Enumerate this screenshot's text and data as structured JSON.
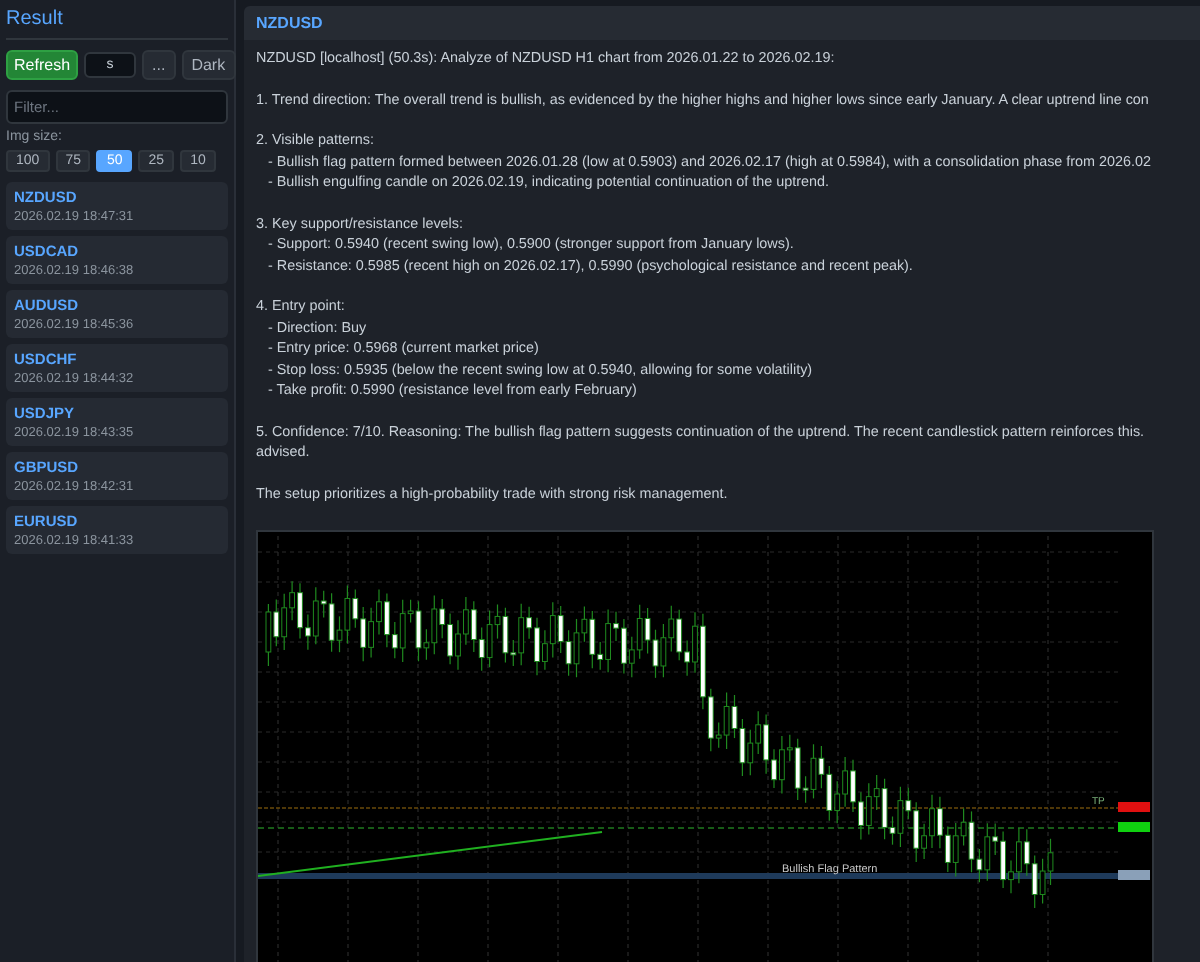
{
  "sidebar": {
    "title": "Result",
    "refresh_button": "Refresh",
    "interval_field": {
      "value": "s"
    },
    "more_button": "...",
    "theme_button": "Dark",
    "filter_field": {
      "placeholder": "Filter..."
    },
    "img_size_label": "Img size:",
    "img_sizes": [
      {
        "label": "100",
        "selected": false
      },
      {
        "label": "75",
        "selected": false
      },
      {
        "label": "50",
        "selected": true
      },
      {
        "label": "25",
        "selected": false
      },
      {
        "label": "10",
        "selected": false
      }
    ],
    "items": [
      {
        "symbol": "NZDUSD",
        "time": "2026.02.19 18:47:31"
      },
      {
        "symbol": "USDCAD",
        "time": "2026.02.19 18:46:38"
      },
      {
        "symbol": "AUDUSD",
        "time": "2026.02.19 18:45:36"
      },
      {
        "symbol": "USDCHF",
        "time": "2026.02.19 18:44:32"
      },
      {
        "symbol": "USDJPY",
        "time": "2026.02.19 18:43:35"
      },
      {
        "symbol": "GBPUSD",
        "time": "2026.02.19 18:42:31"
      },
      {
        "symbol": "EURUSD",
        "time": "2026.02.19 18:41:33"
      }
    ]
  },
  "main": {
    "title": "NZDUSD",
    "paragraphs": [
      [
        "NZDUSD [localhost] (50.3s): Analyze of NZDUSD H1 chart from 2026.01.22 to 2026.02.19:"
      ],
      [
        "1. Trend direction: The overall trend is bullish, as evidenced by the higher highs and higher lows since early January. A clear uptrend line con"
      ],
      [
        "2. Visible patterns:",
        "   - Bullish flag pattern formed between 2026.01.28 (low at 0.5903) and 2026.02.17 (high at 0.5984), with a consolidation phase from 2026.02",
        "   - Bullish engulfing candle on 2026.02.19, indicating potential continuation of the uptrend."
      ],
      [
        "3. Key support/resistance levels:",
        "   - Support: 0.5940 (recent swing low), 0.5900 (stronger support from January lows).",
        "   - Resistance: 0.5985 (recent high on 2026.02.17), 0.5990 (psychological resistance and recent peak)."
      ],
      [
        "4. Entry point:",
        "   - Direction: Buy",
        "   - Entry price: 0.5968 (current market price)",
        "   - Stop loss: 0.5935 (below the recent swing low at 0.5940, allowing for some volatility)",
        "   - Take profit: 0.5990 (resistance level from early February)"
      ],
      [
        "5. Confidence: 7/10. Reasoning: The bullish flag pattern suggests continuation of the uptrend. The recent candlestick pattern reinforces this.",
        "advised."
      ],
      [
        "The setup prioritizes a high-probability trade with strong risk management."
      ]
    ],
    "chart": {
      "tp_label": "TP",
      "pattern_label": "Bullish Flag Pattern"
    }
  }
}
